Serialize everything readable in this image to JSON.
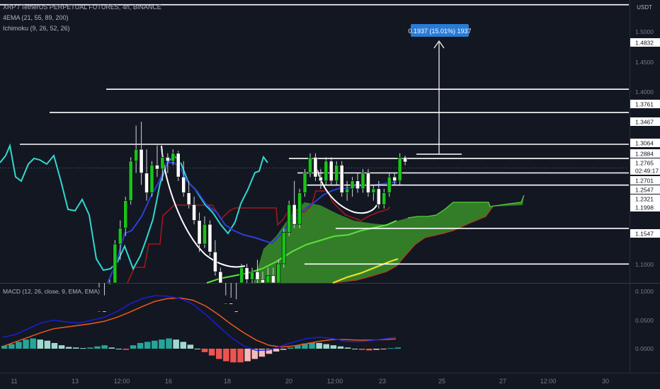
{
  "header": {
    "symbol_line": "XRP / TetherUS PERPETUAL FUTURES, 4h, BINANCE",
    "indicator1": "4EMA (21, 55, 89, 200)",
    "indicator2": "Ichimoku (9, 26, 52, 26)",
    "macd_label": "MACD (12, 26, close, 9, EMA, EMA)",
    "currency": "USDT"
  },
  "colors": {
    "background": "#131722",
    "up_candle": "#19c31b",
    "down_candle": "#ffffff",
    "level_line": "#ffffff",
    "cloud_fill": "#3a8f2a",
    "kijun": "#a0181a",
    "tenkan": "#2e3ed8",
    "ema_fast": "#2fd9cf",
    "ema_mid": "#58e33a",
    "ema_slow": "#e8e22a",
    "macd_line": "#1b1fd8",
    "signal_line": "#f05a1a",
    "hist_pos_strong": "#26a69a",
    "hist_pos_weak": "#9fd9cf",
    "hist_neg_strong": "#ef5350",
    "hist_neg_weak": "#f7b9b8",
    "label_box": "#2a7bd5"
  },
  "measure_label": "0.1937 (15.01%) 1937",
  "price_axis": {
    "ticks": [
      "1.5000",
      "1.4500",
      "1.4000",
      "1.1000"
    ],
    "price_labels": [
      "1.4832",
      "1.3761",
      "1.3467",
      "1.3064",
      "1.2884",
      "1.2765",
      "02:49:17",
      "1.2701",
      "1.2547",
      "1.2321",
      "1.1998",
      "1.1547"
    ]
  },
  "macd_axis": {
    "ticks": [
      "0.1000",
      "0.0500",
      "0.0000"
    ]
  },
  "x_axis": {
    "ticks": [
      "11",
      "13",
      "12:00",
      "16",
      "18",
      "20",
      "12:00",
      "23",
      "25",
      "27",
      "12:00",
      "30"
    ]
  },
  "chart_data": {
    "type": "candlestick",
    "title": "XRP / TetherUS PERPETUAL FUTURES, 4h, BINANCE",
    "y_range": [
      1.08,
      1.53
    ],
    "levels": [
      1.4832,
      1.3761,
      1.3467,
      1.3064,
      1.2884,
      1.2701,
      1.2547,
      1.1998,
      1.1547
    ],
    "candles": [
      {
        "o": 1.085,
        "h": 1.125,
        "l": 1.075,
        "c": 1.095
      },
      {
        "o": 1.095,
        "h": 1.115,
        "l": 1.07,
        "c": 1.09
      },
      {
        "o": 1.09,
        "h": 1.135,
        "l": 1.085,
        "c": 1.13
      },
      {
        "o": 1.13,
        "h": 1.185,
        "l": 1.125,
        "c": 1.18
      },
      {
        "o": 1.18,
        "h": 1.21,
        "l": 1.16,
        "c": 1.2
      },
      {
        "o": 1.2,
        "h": 1.24,
        "l": 1.19,
        "c": 1.235
      },
      {
        "o": 1.235,
        "h": 1.29,
        "l": 1.23,
        "c": 1.285
      },
      {
        "o": 1.285,
        "h": 1.33,
        "l": 1.27,
        "c": 1.3
      },
      {
        "o": 1.3,
        "h": 1.335,
        "l": 1.255,
        "c": 1.27
      },
      {
        "o": 1.27,
        "h": 1.3,
        "l": 1.235,
        "c": 1.245
      },
      {
        "o": 1.245,
        "h": 1.285,
        "l": 1.24,
        "c": 1.28
      },
      {
        "o": 1.28,
        "h": 1.305,
        "l": 1.265,
        "c": 1.275
      },
      {
        "o": 1.275,
        "h": 1.3,
        "l": 1.26,
        "c": 1.29
      },
      {
        "o": 1.29,
        "h": 1.295,
        "l": 1.27,
        "c": 1.285
      },
      {
        "o": 1.285,
        "h": 1.3,
        "l": 1.28,
        "c": 1.295
      },
      {
        "o": 1.295,
        "h": 1.298,
        "l": 1.26,
        "c": 1.265
      },
      {
        "o": 1.265,
        "h": 1.285,
        "l": 1.24,
        "c": 1.245
      },
      {
        "o": 1.245,
        "h": 1.26,
        "l": 1.225,
        "c": 1.23
      },
      {
        "o": 1.23,
        "h": 1.24,
        "l": 1.205,
        "c": 1.21
      },
      {
        "o": 1.21,
        "h": 1.22,
        "l": 1.17,
        "c": 1.18
      },
      {
        "o": 1.18,
        "h": 1.215,
        "l": 1.175,
        "c": 1.205
      },
      {
        "o": 1.205,
        "h": 1.21,
        "l": 1.165,
        "c": 1.17
      },
      {
        "o": 1.17,
        "h": 1.185,
        "l": 1.14,
        "c": 1.145
      },
      {
        "o": 1.145,
        "h": 1.15,
        "l": 1.09,
        "c": 1.1
      },
      {
        "o": 1.1,
        "h": 1.115,
        "l": 1.08,
        "c": 1.105
      },
      {
        "o": 1.105,
        "h": 1.112,
        "l": 1.09,
        "c": 1.095
      },
      {
        "o": 1.095,
        "h": 1.11,
        "l": 1.085,
        "c": 1.09
      },
      {
        "o": 1.09,
        "h": 1.155,
        "l": 1.085,
        "c": 1.15
      },
      {
        "o": 1.15,
        "h": 1.155,
        "l": 1.13,
        "c": 1.135
      },
      {
        "o": 1.135,
        "h": 1.15,
        "l": 1.125,
        "c": 1.145
      },
      {
        "o": 1.145,
        "h": 1.16,
        "l": 1.13,
        "c": 1.135
      },
      {
        "o": 1.135,
        "h": 1.145,
        "l": 1.115,
        "c": 1.12
      },
      {
        "o": 1.12,
        "h": 1.15,
        "l": 1.115,
        "c": 1.14
      },
      {
        "o": 1.14,
        "h": 1.15,
        "l": 1.125,
        "c": 1.13
      },
      {
        "o": 1.13,
        "h": 1.16,
        "l": 1.125,
        "c": 1.155
      },
      {
        "o": 1.155,
        "h": 1.2,
        "l": 1.15,
        "c": 1.195
      },
      {
        "o": 1.195,
        "h": 1.235,
        "l": 1.19,
        "c": 1.23
      },
      {
        "o": 1.23,
        "h": 1.26,
        "l": 1.2,
        "c": 1.205
      },
      {
        "o": 1.205,
        "h": 1.25,
        "l": 1.2,
        "c": 1.245
      },
      {
        "o": 1.245,
        "h": 1.275,
        "l": 1.24,
        "c": 1.27
      },
      {
        "o": 1.27,
        "h": 1.295,
        "l": 1.265,
        "c": 1.29
      },
      {
        "o": 1.29,
        "h": 1.295,
        "l": 1.26,
        "c": 1.265
      },
      {
        "o": 1.265,
        "h": 1.275,
        "l": 1.25,
        "c": 1.26
      },
      {
        "o": 1.26,
        "h": 1.29,
        "l": 1.255,
        "c": 1.285
      },
      {
        "o": 1.285,
        "h": 1.29,
        "l": 1.255,
        "c": 1.26
      },
      {
        "o": 1.26,
        "h": 1.285,
        "l": 1.255,
        "c": 1.28
      },
      {
        "o": 1.28,
        "h": 1.285,
        "l": 1.24,
        "c": 1.245
      },
      {
        "o": 1.245,
        "h": 1.26,
        "l": 1.235,
        "c": 1.25
      },
      {
        "o": 1.25,
        "h": 1.265,
        "l": 1.24,
        "c": 1.26
      },
      {
        "o": 1.26,
        "h": 1.27,
        "l": 1.245,
        "c": 1.25
      },
      {
        "o": 1.25,
        "h": 1.275,
        "l": 1.245,
        "c": 1.27
      },
      {
        "o": 1.27,
        "h": 1.275,
        "l": 1.24,
        "c": 1.245
      },
      {
        "o": 1.245,
        "h": 1.255,
        "l": 1.235,
        "c": 1.25
      },
      {
        "o": 1.25,
        "h": 1.26,
        "l": 1.225,
        "c": 1.23
      },
      {
        "o": 1.23,
        "h": 1.25,
        "l": 1.225,
        "c": 1.245
      },
      {
        "o": 1.245,
        "h": 1.27,
        "l": 1.24,
        "c": 1.265
      },
      {
        "o": 1.265,
        "h": 1.27,
        "l": 1.255,
        "c": 1.26
      },
      {
        "o": 1.26,
        "h": 1.295,
        "l": 1.255,
        "c": 1.29
      },
      {
        "o": 1.29,
        "h": 1.292,
        "l": 1.28,
        "c": 1.284
      }
    ],
    "macd": {
      "y_range": [
        -0.03,
        0.11
      ],
      "macd_line": [
        0.02,
        0.025,
        0.035,
        0.045,
        0.05,
        0.047,
        0.045,
        0.05,
        0.055,
        0.065,
        0.078,
        0.088,
        0.093,
        0.092,
        0.088,
        0.078,
        0.06,
        0.04,
        0.02,
        0.005,
        -0.003,
        -0.002,
        0.005,
        0.012,
        0.018,
        0.02,
        0.018,
        0.013,
        0.012,
        0.014,
        0.017,
        0.02
      ],
      "signal_line": [
        0.004,
        0.012,
        0.02,
        0.028,
        0.035,
        0.038,
        0.041,
        0.044,
        0.048,
        0.055,
        0.064,
        0.074,
        0.083,
        0.088,
        0.089,
        0.085,
        0.075,
        0.06,
        0.043,
        0.028,
        0.015,
        0.006,
        0.003,
        0.005,
        0.009,
        0.013,
        0.016,
        0.016,
        0.015,
        0.015,
        0.016,
        0.017
      ],
      "histogram": [
        0.005,
        0.008,
        0.012,
        0.016,
        0.018,
        0.016,
        0.014,
        0.01,
        0.006,
        0.003,
        0.002,
        0.001,
        0.002,
        0.004,
        0.006,
        0.002,
        0.0,
        -0.002,
        0.006,
        0.01,
        0.012,
        0.014,
        0.016,
        0.018,
        0.016,
        0.012,
        0.007,
        0.0,
        -0.006,
        -0.012,
        -0.018,
        -0.022,
        -0.024,
        -0.024,
        -0.022,
        -0.018,
        -0.014,
        -0.009,
        -0.005,
        -0.002,
        0.002,
        0.006,
        0.009,
        0.011,
        0.01,
        0.008,
        0.006,
        0.004,
        0.002,
        0.0,
        -0.002,
        -0.003,
        -0.002,
        -0.001,
        0.001,
        0.002
      ]
    }
  }
}
